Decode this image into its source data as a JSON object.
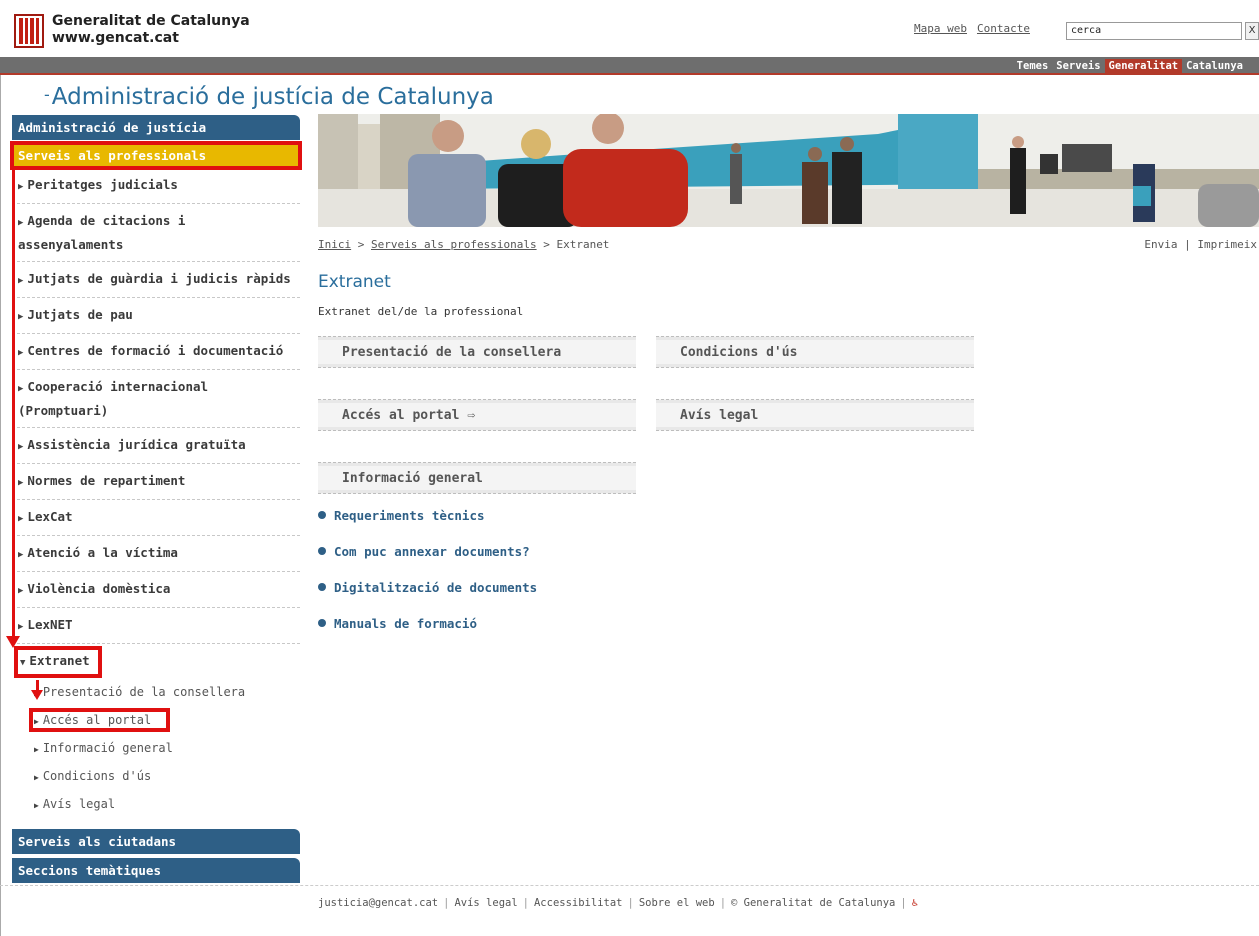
{
  "header": {
    "brand_line1": "Generalitat de Catalunya",
    "brand_line2": "www.gencat.cat",
    "links": [
      "Mapa web",
      "Contacte"
    ],
    "search_value": "cerca",
    "search_button": "X"
  },
  "topnav": {
    "items": [
      "Temes",
      "Serveis",
      "Generalitat",
      "Catalunya"
    ],
    "active": "Generalitat"
  },
  "section_title": "Administració de justícia de Catalunya",
  "sidebar": {
    "head": "Administració de justícia",
    "sub": "Serveis als professionals",
    "items": [
      "Peritatges judicials",
      "Agenda de citacions i assenyalaments",
      "Jutjats de guàrdia i judicis ràpids",
      "Jutjats de pau",
      "Centres de formació i documentació",
      "Cooperació internacional (Promptuari)",
      "Assistència jurídica gratuïta",
      "Normes de repartiment",
      "LexCat",
      "Atenció a la víctima",
      "Violència domèstica",
      "LexNET"
    ],
    "extranet": "Extranet",
    "extranet_sub": [
      "Presentació de la consellera",
      "Accés al portal",
      "Informació general",
      "Condicions d'ús",
      "Avís legal"
    ],
    "head2": "Serveis als ciutadans",
    "head3": "Seccions temàtiques"
  },
  "breadcrumb": {
    "home": "Inici",
    "sep": " > ",
    "parent": "Serveis als professionals",
    "current": "Extranet"
  },
  "tools": {
    "send": "Envia",
    "sep": " | ",
    "print": "Imprimeix"
  },
  "page": {
    "title": "Extranet",
    "subtitle": "Extranet del/de la professional",
    "tiles": {
      "presentacio": "Presentació de la consellera",
      "condicions": "Condicions d'ús",
      "acces": "Accés al portal",
      "acces_arrow": "⇨",
      "avis": "Avís legal",
      "informacio": "Informació general"
    },
    "links": [
      "Requeriments tècnics",
      "Com puc annexar documents?",
      "Digitalització de documents",
      "Manuals de formació"
    ]
  },
  "footer": {
    "email": "justicia@gencat.cat",
    "avis": "Avís legal",
    "accessibilitat": "Accessibilitat",
    "sobre": "Sobre el web",
    "copyright": "© Generalitat de Catalunya",
    "sep": "|"
  }
}
